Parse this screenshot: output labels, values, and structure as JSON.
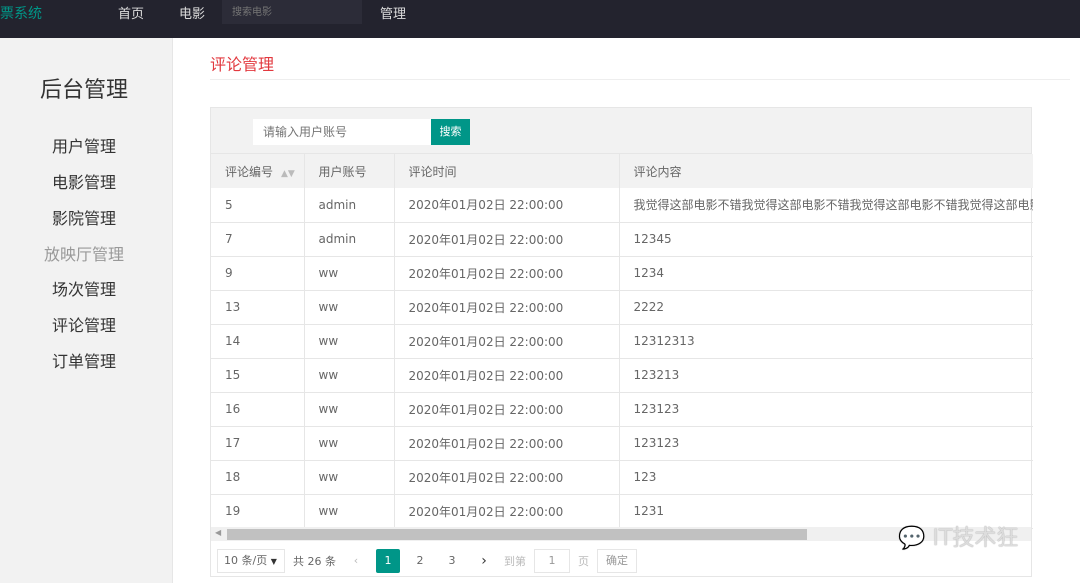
{
  "topbar": {
    "logo": "票系统",
    "nav": [
      "首页",
      "电影"
    ],
    "search_placeholder": "搜索电影",
    "manage": "管理"
  },
  "sidebar": {
    "title": "后台管理",
    "items": [
      "用户管理",
      "电影管理",
      "影院管理",
      "放映厅管理",
      "场次管理",
      "评论管理",
      "订单管理"
    ]
  },
  "page_title": "评论管理",
  "toolbar": {
    "placeholder": "请输入用户账号",
    "search_label": "搜索"
  },
  "table": {
    "headers": [
      "评论编号",
      "用户账号",
      "评论时间",
      "评论内容"
    ],
    "rows": [
      [
        "5",
        "admin",
        "2020年01月02日 22:00:00",
        "我觉得这部电影不错我觉得这部电影不错我觉得这部电影不错我觉得这部电影不错"
      ],
      [
        "7",
        "admin",
        "2020年01月02日 22:00:00",
        "12345"
      ],
      [
        "9",
        "ww",
        "2020年01月02日 22:00:00",
        "1234"
      ],
      [
        "13",
        "ww",
        "2020年01月02日 22:00:00",
        "2222"
      ],
      [
        "14",
        "ww",
        "2020年01月02日 22:00:00",
        "12312313"
      ],
      [
        "15",
        "ww",
        "2020年01月02日 22:00:00",
        "123213"
      ],
      [
        "16",
        "ww",
        "2020年01月02日 22:00:00",
        "123123"
      ],
      [
        "17",
        "ww",
        "2020年01月02日 22:00:00",
        "123123"
      ],
      [
        "18",
        "ww",
        "2020年01月02日 22:00:00",
        "123"
      ],
      [
        "19",
        "ww",
        "2020年01月02日 22:00:00",
        "1231"
      ]
    ]
  },
  "pager": {
    "per_page": "10 条/页",
    "total": "共 26 条",
    "pages": [
      "1",
      "2",
      "3"
    ],
    "goto": "到第",
    "goto_value": "1",
    "page_unit": "页",
    "confirm": "确定"
  },
  "watermark": "IT技术狂",
  "colors": {
    "accent": "#009688",
    "title": "#e2383e",
    "topbar": "#23232e"
  }
}
